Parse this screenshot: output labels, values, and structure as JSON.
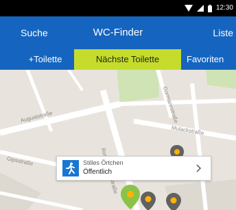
{
  "status_bar": {
    "time": "12:30",
    "icons": [
      "wifi-icon",
      "signal-icon",
      "battery-icon"
    ]
  },
  "app_bar": {
    "left_action": "Suche",
    "title": "WC-Finder",
    "right_action": "Liste"
  },
  "tabs": [
    {
      "label": "+Toilette",
      "active": false
    },
    {
      "label": "Nächste Toilette",
      "active": true
    },
    {
      "label": "Favoriten",
      "active": false
    }
  ],
  "map": {
    "streets": [
      "Auguststraße",
      "Mulackstraße",
      "Gormannstraße",
      "Rosenthaler Straße",
      "Gipsstraße"
    ],
    "popup": {
      "icon": "person-walking-icon",
      "place_name": "Stilles Örtchen",
      "place_type": "Öffentlich"
    },
    "pins": [
      {
        "color": "#ffb300",
        "type": "toilet-pin"
      },
      {
        "color": "#8bc34a",
        "type": "selected-pin"
      },
      {
        "color": "#ffb300",
        "type": "toilet-pin"
      },
      {
        "color": "#ffb300",
        "type": "toilet-pin"
      }
    ]
  },
  "colors": {
    "primary": "#1565c0",
    "active_tab": "#c6dc2d",
    "map_background": "#e8e4dd",
    "pin_dark": "#616161"
  }
}
